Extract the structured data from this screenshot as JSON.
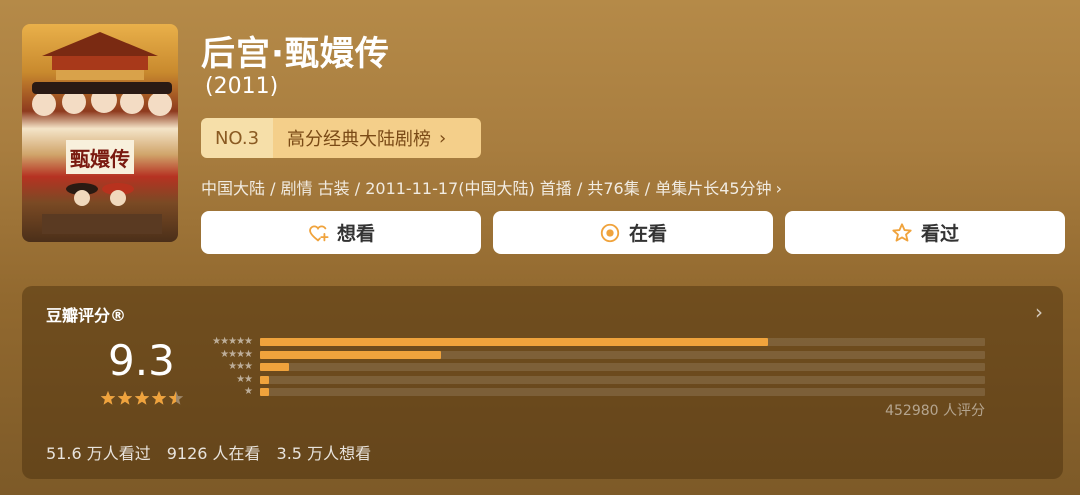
{
  "header": {
    "title": "后宫·甄嬛传",
    "year": "(2011)"
  },
  "poster": {
    "text": "甄嬛传"
  },
  "rank": {
    "number": "NO.3",
    "label": "高分经典大陆剧榜",
    "chevron": "›"
  },
  "meta": {
    "text": "中国大陆 / 剧情 古装 / 2011-11-17(中国大陆) 首播 / 共76集 / 单集片长45分钟",
    "chevron": "›"
  },
  "actions": [
    {
      "label": "想看",
      "icon": "heart-plus-icon"
    },
    {
      "label": "在看",
      "icon": "target-icon"
    },
    {
      "label": "看过",
      "icon": "star-outline-icon"
    }
  ],
  "rating": {
    "title": "豆瓣评分®",
    "arrow": "›",
    "score": "9.3",
    "stars_filled": 4.5,
    "star_color": "#f0a33c",
    "votes": "452980 人评分",
    "distribution": [
      {
        "stars": "★★★★★",
        "fraction": 0.7
      },
      {
        "stars": "★★★★",
        "fraction": 0.25
      },
      {
        "stars": "★★★",
        "fraction": 0.04
      },
      {
        "stars": "★★",
        "fraction": 0.012
      },
      {
        "stars": "★",
        "fraction": 0.012
      }
    ]
  },
  "stats": {
    "watched": "51.6 万人看过",
    "watching": "9126 人在看",
    "want": "3.5 万人想看"
  }
}
